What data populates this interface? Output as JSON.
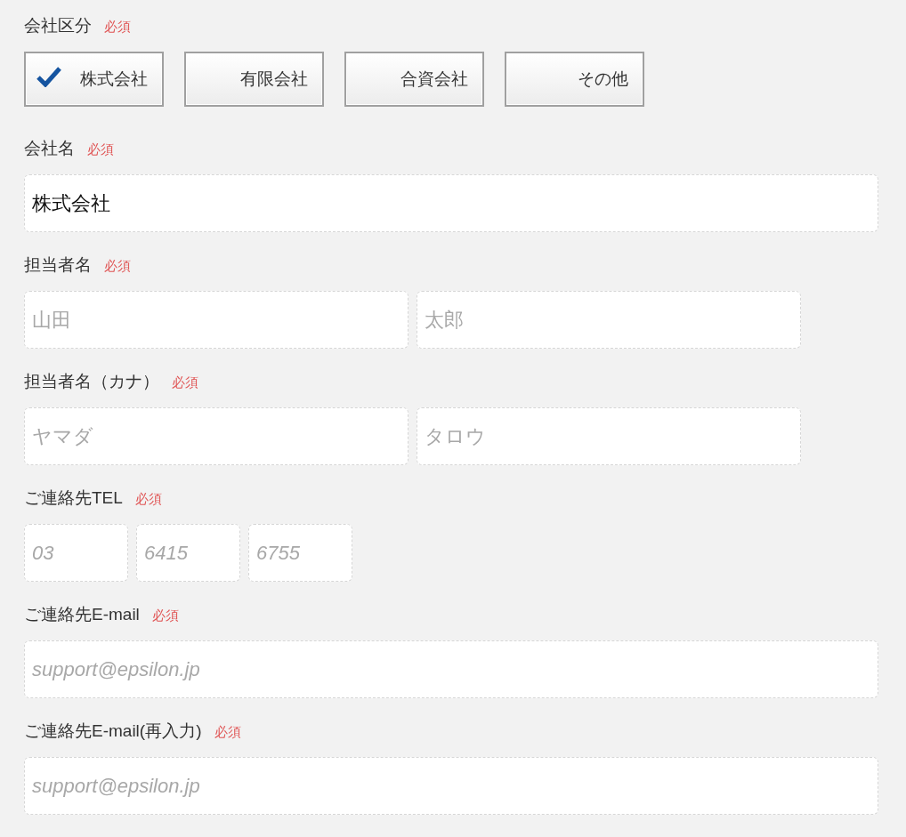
{
  "sections": [
    {
      "kind": "choice",
      "label": "会社区分",
      "required": "必須",
      "options": [
        {
          "label": "株式会社",
          "selected": true
        },
        {
          "label": "有限会社",
          "selected": false
        },
        {
          "label": "合資会社",
          "selected": false
        },
        {
          "label": "その他",
          "selected": false
        }
      ]
    },
    {
      "kind": "full",
      "label": "会社名",
      "required": "必須",
      "fields": [
        {
          "value": "株式会社"
        }
      ]
    },
    {
      "kind": "pair",
      "label": "担当者名",
      "required": "必須",
      "fields": [
        {
          "placeholder": "山田"
        },
        {
          "placeholder": "太郎"
        }
      ]
    },
    {
      "kind": "pair",
      "label": "担当者名（カナ）",
      "required": "必須",
      "fields": [
        {
          "placeholder": "ヤマダ"
        },
        {
          "placeholder": "タロウ"
        }
      ]
    },
    {
      "kind": "tel",
      "label": "ご連絡先TEL",
      "required": "必須",
      "fields": [
        {
          "placeholder": "03"
        },
        {
          "placeholder": "6415"
        },
        {
          "placeholder": "6755"
        }
      ]
    },
    {
      "kind": "email",
      "label": "ご連絡先E-mail",
      "required": "必須",
      "fields": [
        {
          "placeholder": "support@epsilon.jp"
        }
      ]
    },
    {
      "kind": "email",
      "label": "ご連絡先E-mail(再入力)",
      "required": "必須",
      "fields": [
        {
          "placeholder": "support@epsilon.jp"
        }
      ]
    }
  ]
}
